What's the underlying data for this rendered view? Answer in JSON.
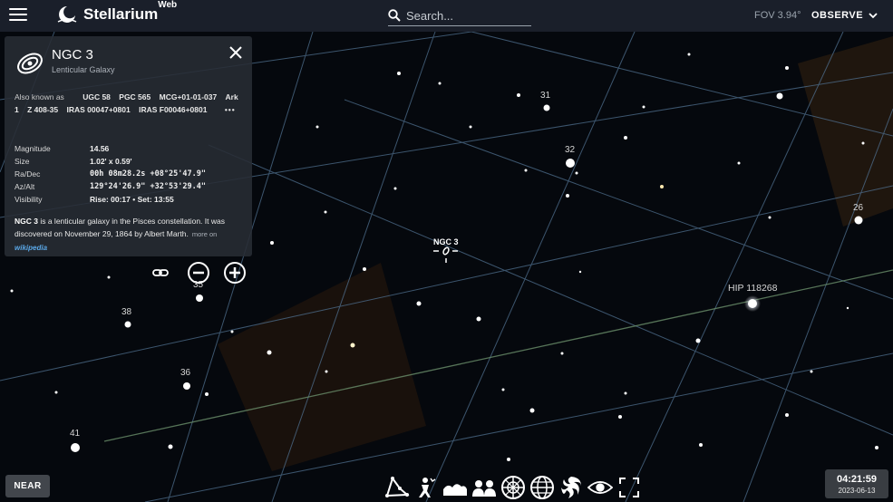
{
  "app": {
    "title": "Stellarium",
    "title_sup": "Web"
  },
  "search": {
    "placeholder": "Search..."
  },
  "fov": "FOV 3.94°",
  "observe_label": "OBSERVE",
  "info": {
    "name": "NGC 3",
    "type": "Lenticular Galaxy",
    "aka_label": "Also known as",
    "aka": [
      "UGC 58",
      "PGC 565",
      "MCG+01-01-037",
      "Ark 1",
      "Z 408-35",
      "IRAS 00047+0801",
      "IRAS F00046+0801"
    ],
    "aka_more": "•••",
    "props": [
      {
        "key": "Magnitude",
        "value": "14.56"
      },
      {
        "key": "Size",
        "value": "1.02' x 0.59'"
      },
      {
        "key": "Ra/Dec",
        "value": "00h 08m28.2s  +08°25'47.9\""
      },
      {
        "key": "Az/Alt",
        "value": "129°24'26.9\"  +32°53'29.4\""
      },
      {
        "key": "Visibility",
        "value": "Rise: 00:17 • Set: 13:55"
      }
    ],
    "desc_name": "NGC 3",
    "desc_text": " is a lenticular galaxy in the Pisces constellation. It was discovered on November 29, 1864 by Albert Marth.",
    "more_on": "more on",
    "wiki": "wikipedia"
  },
  "sky_labels": {
    "s31": "31",
    "s32": "32",
    "s26": "26",
    "s35": "35",
    "s38": "38",
    "s36": "36",
    "s41": "41",
    "hip": "HIP 118268",
    "ngc": "NGC 3"
  },
  "near_label": "NEAR",
  "clock": {
    "time": "04:21:59",
    "date": "2023-06-13"
  },
  "colors": {
    "bar": "#1c222c",
    "panel": "#282c34",
    "grid": "#5a7ea0",
    "ecliptic": "#6b8f6b",
    "link": "#5aa7e6"
  },
  "bottom_icons": [
    "constellation-lines-icon",
    "constellation-art-icon",
    "landscape-icon",
    "atmosphere-icon",
    "azimuthal-grid-icon",
    "equatorial-grid-icon",
    "deep-sky-icon",
    "night-mode-icon",
    "fullscreen-icon"
  ]
}
